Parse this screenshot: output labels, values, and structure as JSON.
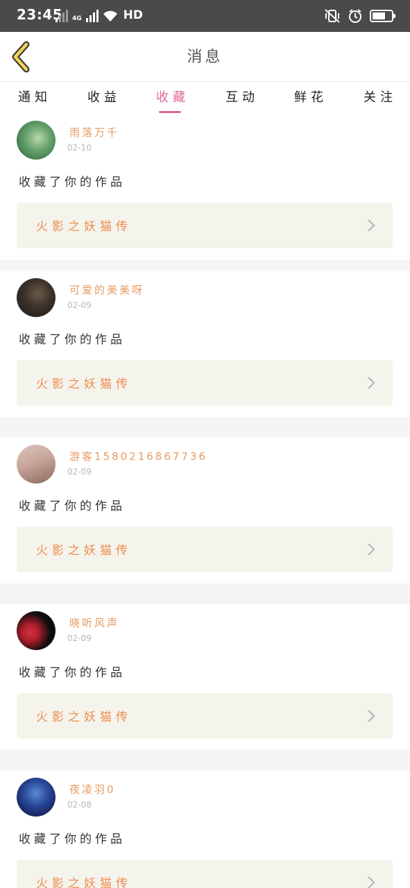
{
  "status_bar": {
    "time": "23:45",
    "network": "4G",
    "hd": "HD",
    "battery_level": 0.7
  },
  "header": {
    "title": "消息"
  },
  "tabs": [
    {
      "label": "通知",
      "active": false
    },
    {
      "label": "收益",
      "active": false
    },
    {
      "label": "收藏",
      "active": true
    },
    {
      "label": "互动",
      "active": false
    },
    {
      "label": "鲜花",
      "active": false
    },
    {
      "label": "关注",
      "active": false
    }
  ],
  "messages": [
    {
      "username": "雨落万千",
      "date": "02-10",
      "action": "收藏了你的作品",
      "work_title": "火影之妖猫传",
      "avatar_colors": [
        "#3f7d4a",
        "#b9d9a8"
      ]
    },
    {
      "username": "可爱的美美呀",
      "date": "02-09",
      "action": "收藏了你的作品",
      "work_title": "火影之妖猫传",
      "avatar_colors": [
        "#1e1e1e",
        "#5a4a3a"
      ]
    },
    {
      "username": "游客1580216867736",
      "date": "02-09",
      "action": "收藏了你的作品",
      "work_title": "火影之妖猫传",
      "avatar_colors": [
        "#c9a59a",
        "#8a6a5e"
      ]
    },
    {
      "username": "晓听风声",
      "date": "02-09",
      "action": "收藏了你的作品",
      "work_title": "火影之妖猫传",
      "avatar_colors": [
        "#0d0d0d",
        "#b01e2a"
      ]
    },
    {
      "username": "夜凌羽0",
      "date": "02-08",
      "action": "收藏了你的作品",
      "work_title": "火影之妖猫传",
      "avatar_colors": [
        "#1a2a6a",
        "#5a8ad6"
      ]
    }
  ],
  "colors": {
    "accent": "#e0679b",
    "username": "#e79a60",
    "work_title": "#ef8c50",
    "work_box_bg": "#f4f4ec"
  }
}
